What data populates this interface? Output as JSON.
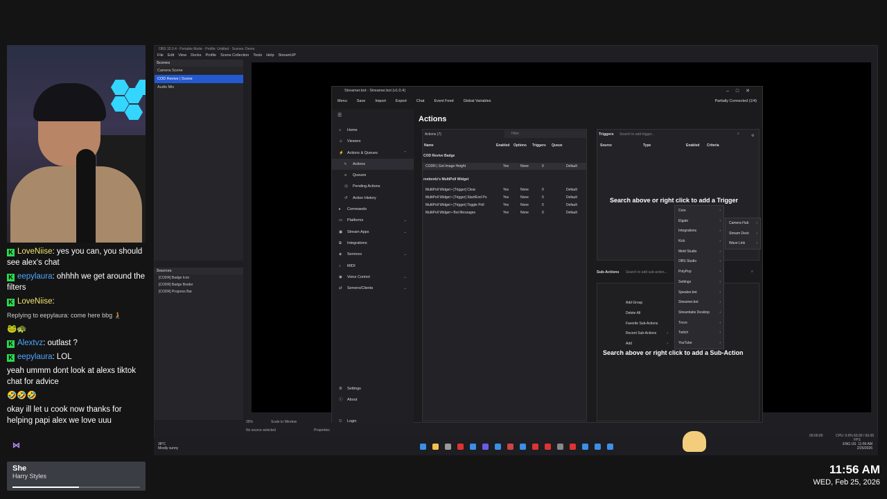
{
  "chat": {
    "lines": [
      {
        "user": "LoveNiise",
        "text": "yes you can, you should see alex's chat"
      },
      {
        "user": "eepylaura",
        "text": "ohhhh we get around the filters"
      },
      {
        "user": "LoveNiise",
        "text": ""
      },
      {
        "reply": "Replying to eepylaura: come here bbg 🧎"
      },
      {
        "emotes": "🐸🐢"
      },
      {
        "user": "Alextvz",
        "text": "outlast ?"
      },
      {
        "user": "eepylaura",
        "text": "LOL"
      },
      {
        "text": "yeah ummm dont look at alexs tiktok chat for advice"
      },
      {
        "emotes": "🤣🤣🤣"
      },
      {
        "text": "okay ill let u cook now thanks for helping papi alex we love uuu"
      }
    ]
  },
  "now_playing": {
    "title": "She",
    "artist": "Harry Styles",
    "progress": 0.52
  },
  "clock": {
    "time": "11:56 AM",
    "date": "WED, Feb 25, 2026"
  },
  "obs": {
    "title": "OBS 32.0.4 - Portable Mode - Profile: Untitled - Scenes: Demo",
    "menu": [
      "File",
      "Edit",
      "View",
      "Docks",
      "Profile",
      "Scene Collection",
      "Tools",
      "Help",
      "StreamUP"
    ],
    "scenes_header": "Scenes",
    "scenes": [
      "Camera Scene",
      "COD Revive | Scene",
      "Audio Mix"
    ],
    "sources_header": "Sources",
    "sources": [
      "[CODR] Badge Icon",
      "[CODR] Badge Border",
      "[CODR] Progress Bar"
    ],
    "status": "No source selected",
    "zoom": "35%",
    "scale": "Scale to Window",
    "properties": "Properties"
  },
  "streamerbot": {
    "title": "Streamer.bot - Streamer.bot (v1.0.4)",
    "toolbar": [
      "Menu",
      "Save",
      "Import",
      "Export",
      "Chat",
      "Event Feed",
      "Global Variables"
    ],
    "connection": "Partially Connected (1/4)",
    "nav": [
      {
        "label": "Home",
        "icon": "⌂"
      },
      {
        "label": "Viewers",
        "icon": "☺"
      },
      {
        "label": "Actions & Queues",
        "icon": "⚡",
        "chev": "⌃"
      },
      {
        "label": "Actions",
        "icon": "ϟ",
        "sub": true,
        "active": true
      },
      {
        "label": "Queues",
        "icon": "≡",
        "sub": true
      },
      {
        "label": "Pending Actions",
        "icon": "◷",
        "sub": true
      },
      {
        "label": "Action History",
        "icon": "↺",
        "sub": true
      },
      {
        "label": "Commands",
        "icon": "▸"
      },
      {
        "label": "Platforms",
        "icon": "▭",
        "chev": "⌄"
      },
      {
        "label": "Stream Apps",
        "icon": "▣",
        "chev": "⌄"
      },
      {
        "label": "Integrations",
        "icon": "⧉"
      },
      {
        "label": "Services",
        "icon": "◈",
        "chev": "⌄"
      },
      {
        "label": "MIDI",
        "icon": "♪"
      },
      {
        "label": "Voice Control",
        "icon": "◉",
        "chev": "⌄"
      },
      {
        "label": "Servers/Clients",
        "icon": "⇄",
        "chev": "⌄"
      }
    ],
    "nav_bottom": [
      "Settings",
      "About",
      "Login"
    ],
    "actions_title": "Actions",
    "actions_count": "Actions (7)",
    "filter_placeholder": "Filter",
    "columns": [
      "Name",
      "Enabled",
      "Options",
      "Triggers",
      "Queue"
    ],
    "groups": [
      {
        "name": "COD Revive Badge",
        "rows": [
          {
            "name": "CODR | Get Image Height",
            "enabled": "Yes",
            "options": "None",
            "triggers": "0",
            "queue": "Default"
          }
        ]
      },
      {
        "name": "rexbordz's MultiPoll Widget",
        "rows": [
          {
            "name": "MultiPoll Widget • [Trigger] Clear",
            "enabled": "Yes",
            "options": "None",
            "triggers": "0",
            "queue": "Default"
          },
          {
            "name": "MultiPoll Widget • [Trigger] Start/End Po",
            "enabled": "Yes",
            "options": "None",
            "triggers": "0",
            "queue": "Default"
          },
          {
            "name": "MultiPoll Widget • [Trigger] Toggle Poll",
            "enabled": "Yes",
            "options": "None",
            "triggers": "0",
            "queue": "Default"
          },
          {
            "name": "MultiPoll Widget • Bot Messages",
            "enabled": "Yes",
            "options": "None",
            "triggers": "0",
            "queue": "Default"
          }
        ]
      }
    ],
    "triggers": {
      "title": "Triggers",
      "search": "Search to add trigger...",
      "columns": [
        "Source",
        "Type",
        "Enabled",
        "Criteria"
      ],
      "empty": "Search above or right click to add a Trigger"
    },
    "subactions": {
      "title": "Sub-Actions",
      "search": "Search to add sub-action...",
      "empty": "Search above or right click to add a Sub-Action"
    },
    "trigger_menu": [
      "Core",
      "Elgato",
      "Integrations",
      "Kick",
      "Meld Studio",
      "OBS Studio",
      "PolyPop",
      "Settings",
      "Speaker.bot",
      "Streamer.bot",
      "Streamlabs Desktop",
      "Trovo",
      "Twitch",
      "YouTube"
    ],
    "elgato_submenu": [
      "Camera Hub",
      "Stream Deck",
      "Wave Link"
    ],
    "subaction_menu": [
      "Add Group",
      "Delete All",
      "Favorite Sub-Actions",
      "Recent Sub-Actions",
      "Add"
    ]
  },
  "taskbar": {
    "weather_temp": "38°C",
    "weather_desc": "Mostly sunny",
    "tray_lang": "ENG US",
    "tray_time": "11:56 AM",
    "tray_date": "2/25/2026",
    "cpu": "CPU: 0.6%",
    "fps": "60.00 / 60.00 FPS",
    "rec_time": "00:00:00"
  }
}
